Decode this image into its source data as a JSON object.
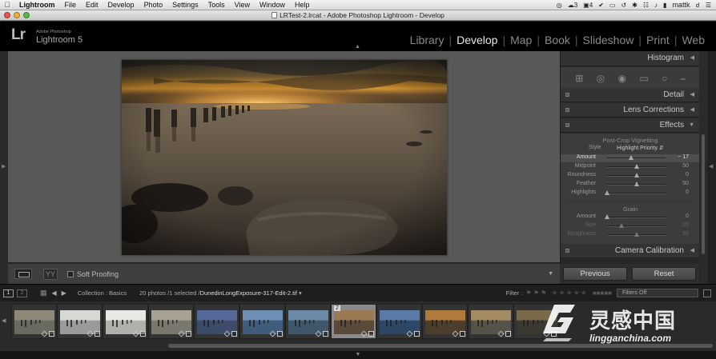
{
  "menubar": {
    "app": "Lightroom",
    "items": [
      "File",
      "Edit",
      "Develop",
      "Photo",
      "Settings",
      "Tools",
      "View",
      "Window",
      "Help"
    ],
    "status": {
      "badge1": "3",
      "badge2": "4",
      "user": "mattk"
    }
  },
  "window": {
    "title": "LRTest-2.lrcat - Adobe Photoshop Lightroom - Develop"
  },
  "header": {
    "adobe": "Adobe Photoshop",
    "product": "Lightroom 5",
    "logo": "Lr",
    "modules": [
      {
        "label": "Library",
        "active": false
      },
      {
        "label": "Develop",
        "active": true
      },
      {
        "label": "Map",
        "active": false
      },
      {
        "label": "Book",
        "active": false
      },
      {
        "label": "Slideshow",
        "active": false
      },
      {
        "label": "Print",
        "active": false
      },
      {
        "label": "Web",
        "active": false
      }
    ]
  },
  "toolbar": {
    "soft_proofing": "Soft Proofing",
    "view_mode": "YY"
  },
  "right_panel": {
    "histogram": "Histogram",
    "detail": "Detail",
    "lens": "Lens Corrections",
    "effects": "Effects",
    "vignette_title": "Post-Crop Vignetting",
    "style_label": "Style",
    "style_value": "Highlight Priority",
    "vignette": [
      {
        "label": "Amount",
        "value": "− 17",
        "pos": 0.41,
        "highlight": true
      },
      {
        "label": "Midpoint",
        "value": "50",
        "pos": 0.5
      },
      {
        "label": "Roundness",
        "value": "0",
        "pos": 0.5
      },
      {
        "label": "Feather",
        "value": "50",
        "pos": 0.5
      },
      {
        "label": "Highlights",
        "value": "0",
        "pos": 0.0
      }
    ],
    "grain_title": "Grain",
    "grain": [
      {
        "label": "Amount",
        "value": "0",
        "pos": 0.0
      },
      {
        "label": "Size",
        "value": "25",
        "pos": 0.25,
        "dim": true
      },
      {
        "label": "Roughness",
        "value": "50",
        "pos": 0.5,
        "dim": true
      }
    ],
    "camera_calibration": "Camera Calibration",
    "previous": "Previous",
    "reset": "Reset"
  },
  "filmstrip": {
    "page1": "1",
    "page2": "2",
    "collection": "Collection : Basics",
    "count": "20 photos /1 selected /",
    "filename": "DunedinLongExposure-317-Edit-2.tif",
    "filename_arrow": "▾",
    "filter_label": "Filter :",
    "filter_value": "Filters Off",
    "selected_number": "2",
    "thumbs": [
      {
        "tone": "#6a6a5e",
        "sky": "#8d8878"
      },
      {
        "tone": "#9a9a98",
        "sky": "#d8d8d4"
      },
      {
        "tone": "#b0b0ac",
        "sky": "#e8e8e4"
      },
      {
        "tone": "#7a776c",
        "sky": "#a8a294"
      },
      {
        "tone": "#3c4b6a",
        "sky": "#56689a"
      },
      {
        "tone": "#3f5c7c",
        "sky": "#6d8fb4"
      },
      {
        "tone": "#40566a",
        "sky": "#6a8aa6"
      },
      {
        "tone": "#5a4a3a",
        "sky": "#9a7a52"
      },
      {
        "tone": "#2e4766",
        "sky": "#5a7aa8"
      },
      {
        "tone": "#4c3e2c",
        "sky": "#b07a3a"
      },
      {
        "tone": "#55524a",
        "sky": "#a48c62"
      },
      {
        "tone": "#3a3830",
        "sky": "#7a6a4a"
      }
    ]
  },
  "watermark": {
    "cn": "灵感中国",
    "url": "lingganchina.com"
  },
  "colors": {
    "accent": "#e6e6e6",
    "panel": "#2b2b2b",
    "viewer": "#585858"
  }
}
